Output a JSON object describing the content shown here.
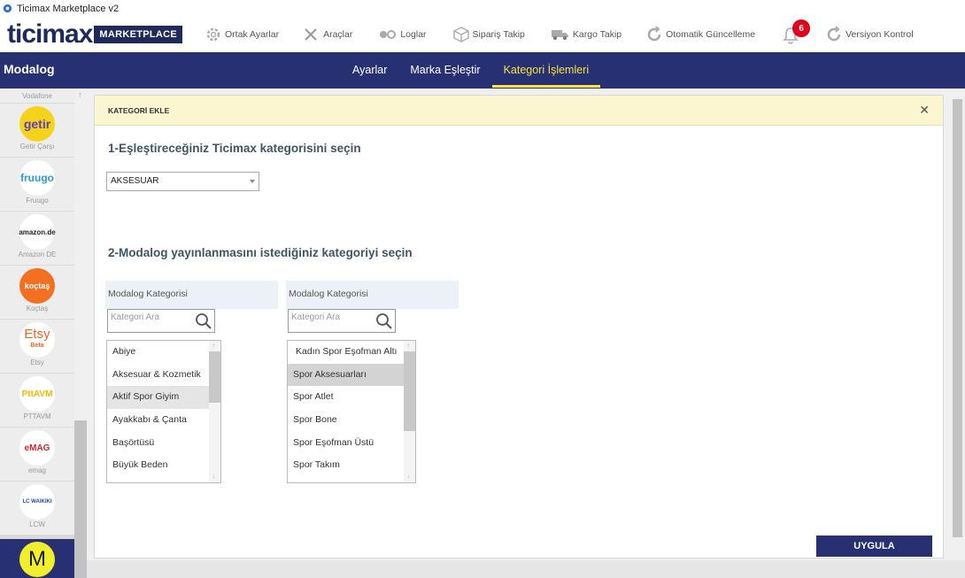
{
  "window": {
    "title": "Ticimax Marketplace v2"
  },
  "logo": {
    "text": "ticimax",
    "badge": "MARKETPLACE"
  },
  "topnav": {
    "items": [
      {
        "label": "Ortak Ayarlar",
        "icon": "gear-icon"
      },
      {
        "label": "Araçlar",
        "icon": "tools-icon"
      },
      {
        "label": "Loglar",
        "icon": "log-icon"
      },
      {
        "label": "Sipariş Takip",
        "icon": "box-icon"
      },
      {
        "label": "Kargo Takip",
        "icon": "truck-icon"
      },
      {
        "label": "Otomatik Güncelleme",
        "icon": "refresh-icon"
      },
      {
        "label": "Versiyon Kontrol",
        "icon": "refresh-icon"
      }
    ],
    "notification_count": "6"
  },
  "header": {
    "title": "Modalog",
    "tabs": [
      {
        "label": "Ayarlar",
        "active": false
      },
      {
        "label": "Marka Eşleştir",
        "active": false
      },
      {
        "label": "Kategori İşlemleri",
        "active": true
      }
    ]
  },
  "sidebar": {
    "items": [
      {
        "label": "Vodafone",
        "logo": ""
      },
      {
        "label": "Getir Çarşı",
        "logo": "getir",
        "bg": "#f6d31b",
        "fg": "#5d3ebc"
      },
      {
        "label": "Fruugo",
        "logo": "fruugo",
        "bg": "#ffffff",
        "fg": "#2c9ad6"
      },
      {
        "label": "Amazon DE",
        "logo": "amazon.de",
        "bg": "#ffffff",
        "fg": "#222222"
      },
      {
        "label": "Koçtaş",
        "logo": "koçtaş",
        "bg": "#f36f21",
        "fg": "#ffffff"
      },
      {
        "label": "Etsy",
        "logo": "Etsy",
        "sub": "Beta",
        "bg": "#ffffff",
        "fg": "#f1641e"
      },
      {
        "label": "PTTAVM",
        "logo": "PttAVM",
        "bg": "#ffffff",
        "fg": "#f5b800"
      },
      {
        "label": "emag",
        "logo": "eMAG",
        "bg": "#ffffff",
        "fg": "#d5252b"
      },
      {
        "label": "LCW",
        "logo": "LC WAIKIKI",
        "bg": "#ffffff",
        "fg": "#1f4ea0"
      },
      {
        "label": "",
        "logo": "M",
        "bg": "#f1ee2c",
        "fg": "#1a1a1a"
      }
    ]
  },
  "panel": {
    "header": "KATEGORİ EKLE",
    "step1": "1-Eşleştireceğiniz Ticimax kategorisini seçin",
    "select_value": "AKSESUAR",
    "step2": "2-Modalog yayınlanmasını istediğiniz kategoriyi seçin",
    "left": {
      "head": "Modalog Kategorisi",
      "placeholder": "Kategori Ara",
      "items": [
        "Abiye",
        "Aksesuar & Kozmetik",
        "Aktif Spor Giyim",
        "Ayakkabı & Çanta",
        "Başörtüsü",
        "Büyük Beden"
      ]
    },
    "right": {
      "head": "Modalog Kategorisi",
      "placeholder": "Kategori Ara",
      "items": [
        "Kadın Spor Eşofman Altı",
        "Spor Aksesuarları",
        "Spor Atlet",
        "Spor Bone",
        "Spor Eşofman Üstü",
        "Spor Takım"
      ]
    },
    "apply": "UYGULA"
  }
}
